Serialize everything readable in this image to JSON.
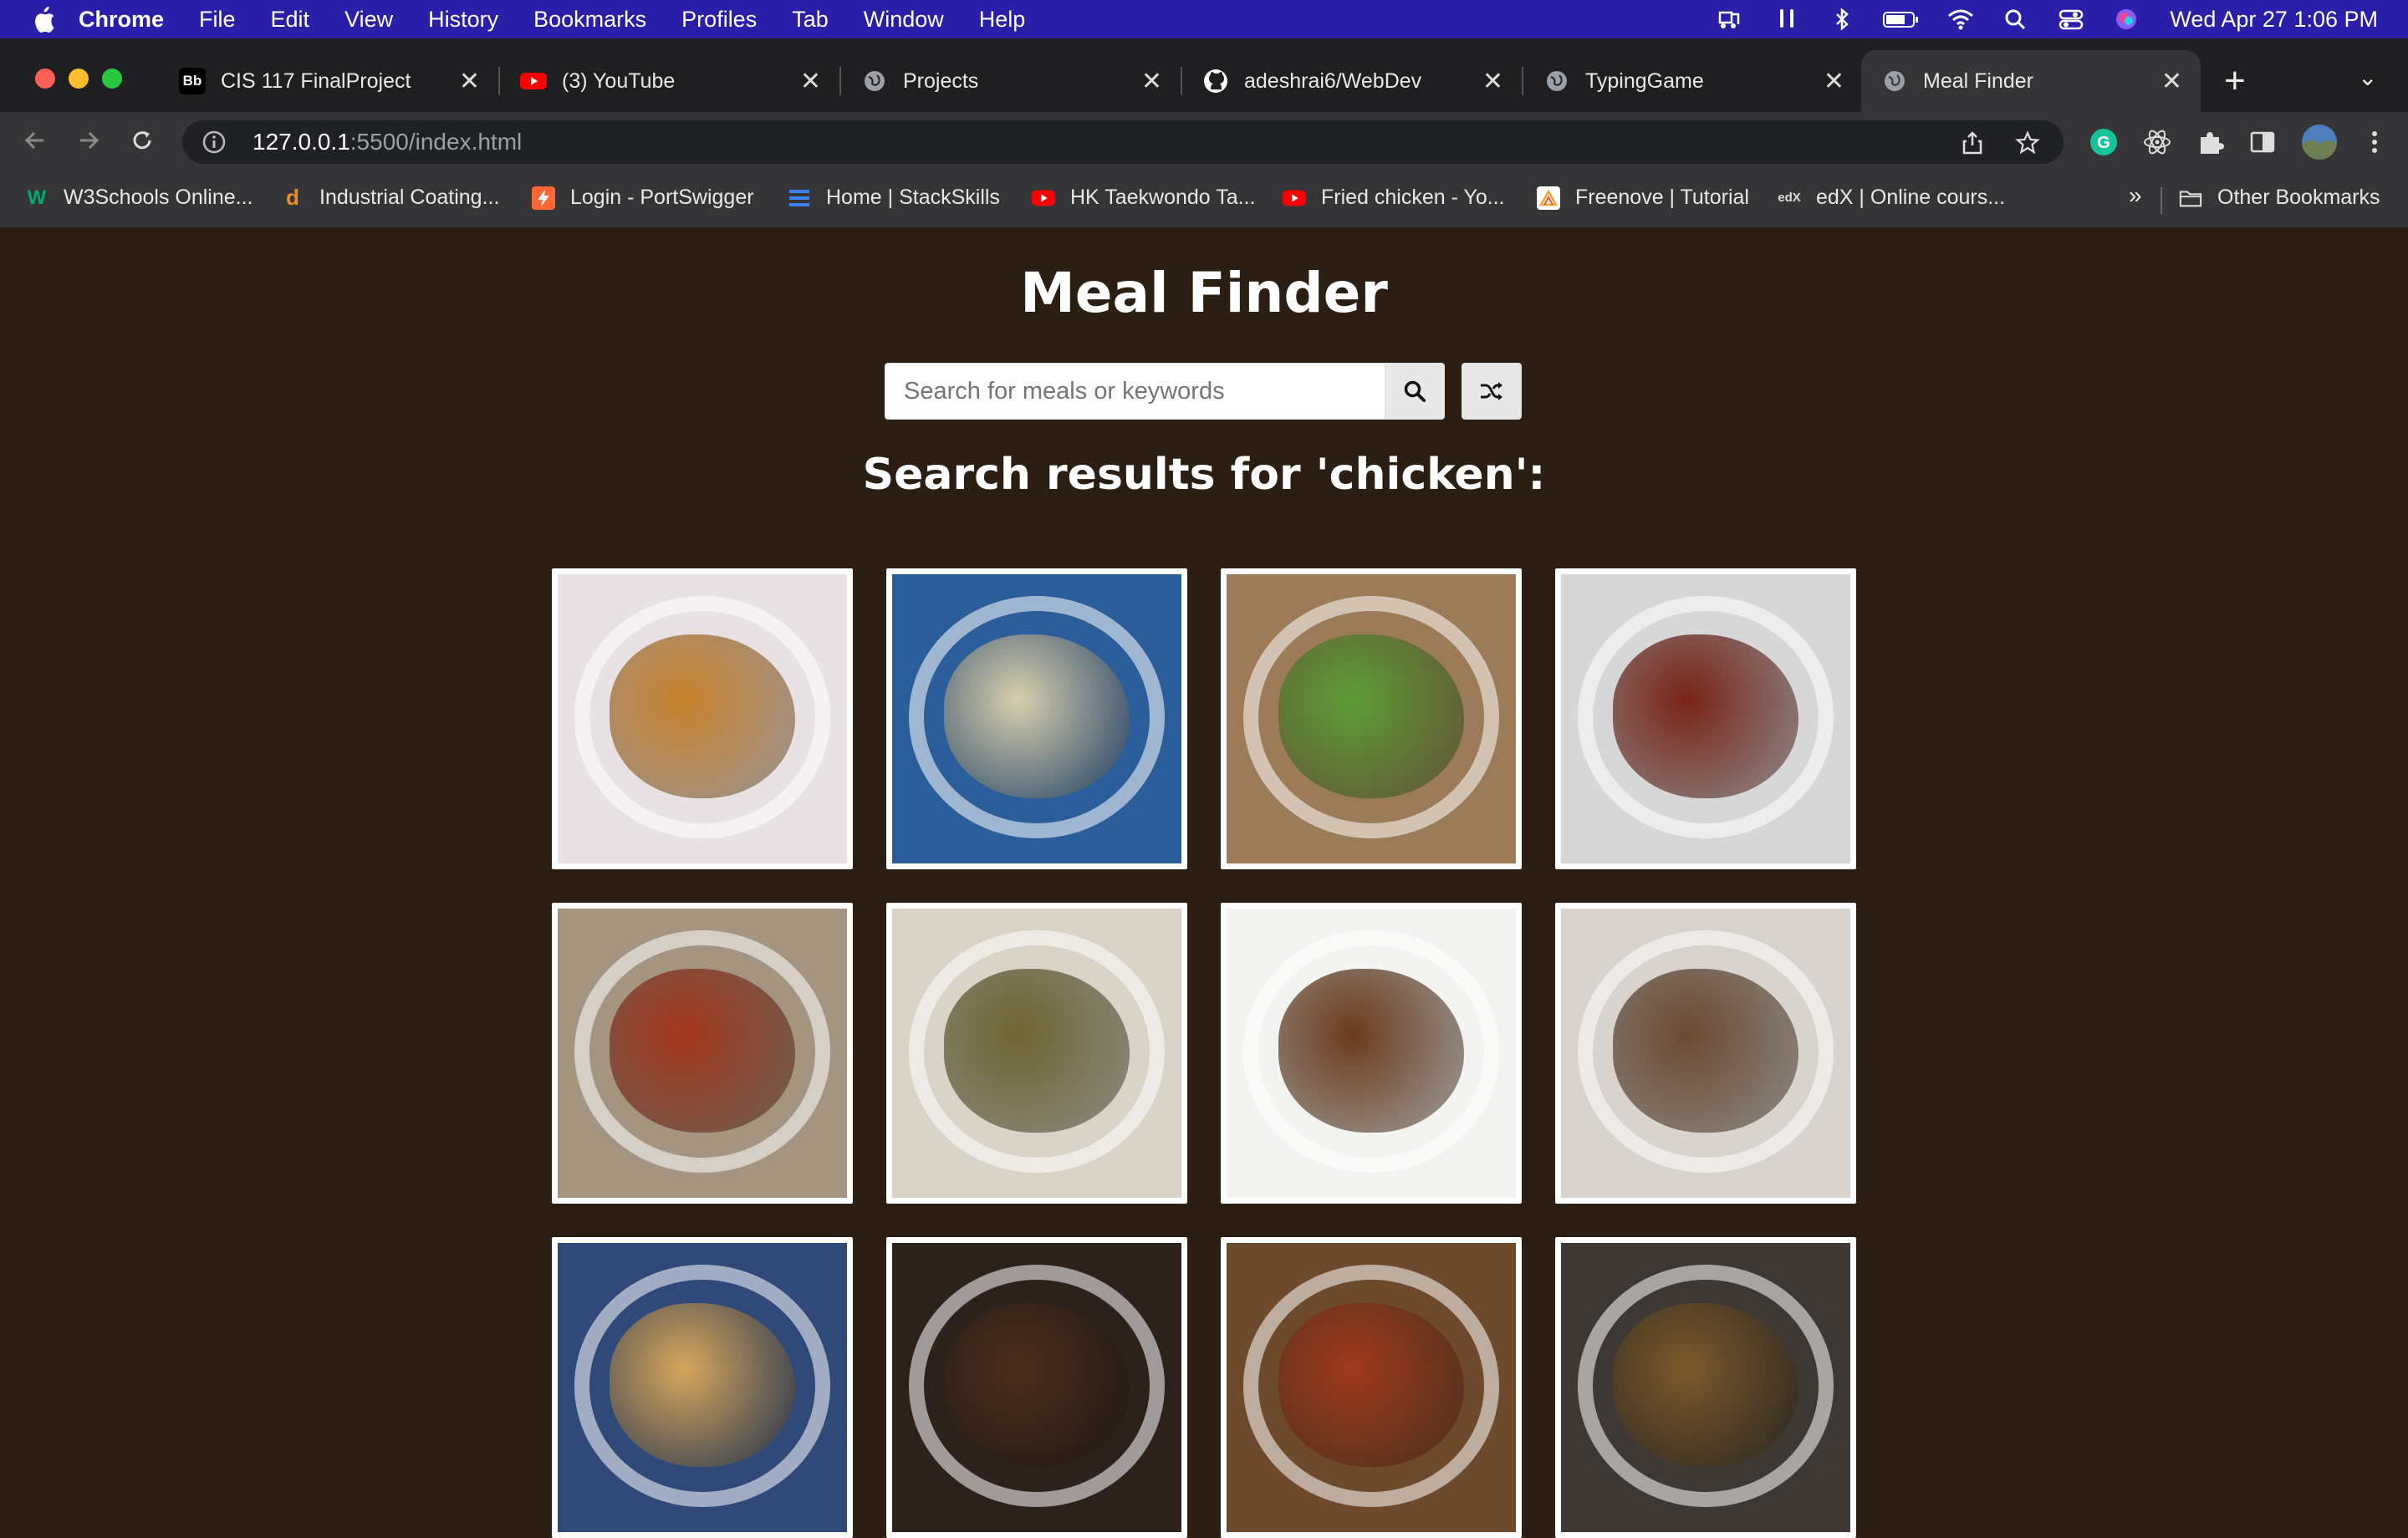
{
  "menubar": {
    "app": "Chrome",
    "items": [
      "File",
      "Edit",
      "View",
      "History",
      "Bookmarks",
      "Profiles",
      "Tab",
      "Window",
      "Help"
    ],
    "clock": "Wed Apr 27  1:06 PM"
  },
  "tabs": [
    {
      "title": "CIS 117 FinalProject",
      "favicon": "Bb",
      "favicon_color": "#000000"
    },
    {
      "title": "(3) YouTube",
      "favicon": "youtube-icon",
      "favicon_color": "#ff0000"
    },
    {
      "title": "Projects",
      "favicon": "globe-icon",
      "favicon_color": "#9aa0a6"
    },
    {
      "title": "adeshrai6/WebDev",
      "favicon": "github-icon",
      "favicon_color": "#ffffff"
    },
    {
      "title": "TypingGame",
      "favicon": "globe-icon",
      "favicon_color": "#9aa0a6"
    },
    {
      "title": "Meal Finder",
      "favicon": "globe-icon",
      "favicon_color": "#9aa0a6",
      "active": true
    }
  ],
  "address": {
    "host": "127.0.0.1",
    "path": ":5500/index.html"
  },
  "bookmarks": [
    {
      "label": "W3Schools Online...",
      "icon": "W",
      "color": "#04aa6d"
    },
    {
      "label": "Industrial Coating...",
      "icon": "d",
      "color": "#f08a24"
    },
    {
      "label": "Login - PortSwigger",
      "icon": "bolt-icon",
      "color": "#ff6633"
    },
    {
      "label": "Home | StackSkills",
      "icon": "stack-icon",
      "color": "#3b82f6"
    },
    {
      "label": "HK Taekwondo Ta...",
      "icon": "youtube-icon",
      "color": "#ff0000"
    },
    {
      "label": "Fried chicken - Yo...",
      "icon": "youtube-icon",
      "color": "#ff0000"
    },
    {
      "label": "Freenove | Tutorial",
      "icon": "freenove-icon",
      "color": "#f2a33a"
    },
    {
      "label": "edX | Online cours...",
      "icon": "edX",
      "color": "#02262b"
    }
  ],
  "other_bookmarks": "Other Bookmarks",
  "overflow": "»",
  "page": {
    "title": "Meal Finder",
    "search_placeholder": "Search for meals or keywords",
    "results_heading": "Search results for 'chicken':"
  },
  "meals": [
    {
      "name": "meal-1",
      "bg": "#e9e2e4",
      "food": "#c9822c"
    },
    {
      "name": "meal-2",
      "bg": "#2a5d9a",
      "food": "#d8cfae"
    },
    {
      "name": "meal-3",
      "bg": "#9b7b58",
      "food": "#5d9c35"
    },
    {
      "name": "meal-4",
      "bg": "#d7d7d8",
      "food": "#7a2418"
    },
    {
      "name": "meal-5",
      "bg": "#a59480",
      "food": "#a2361c"
    },
    {
      "name": "meal-6",
      "bg": "#d9d3c8",
      "food": "#6e6633"
    },
    {
      "name": "meal-7",
      "bg": "#f3f3f2",
      "food": "#6b3c1c"
    },
    {
      "name": "meal-8",
      "bg": "#d8d3cc",
      "food": "#6a4a33"
    },
    {
      "name": "meal-9",
      "bg": "#2f4a78",
      "food": "#d6a75d"
    },
    {
      "name": "meal-10",
      "bg": "#2d221b",
      "food": "#4b3020"
    },
    {
      "name": "meal-11",
      "bg": "#6e4a2c",
      "food": "#a03a1d"
    },
    {
      "name": "meal-12",
      "bg": "#3d3833",
      "food": "#7b5a2b"
    }
  ]
}
